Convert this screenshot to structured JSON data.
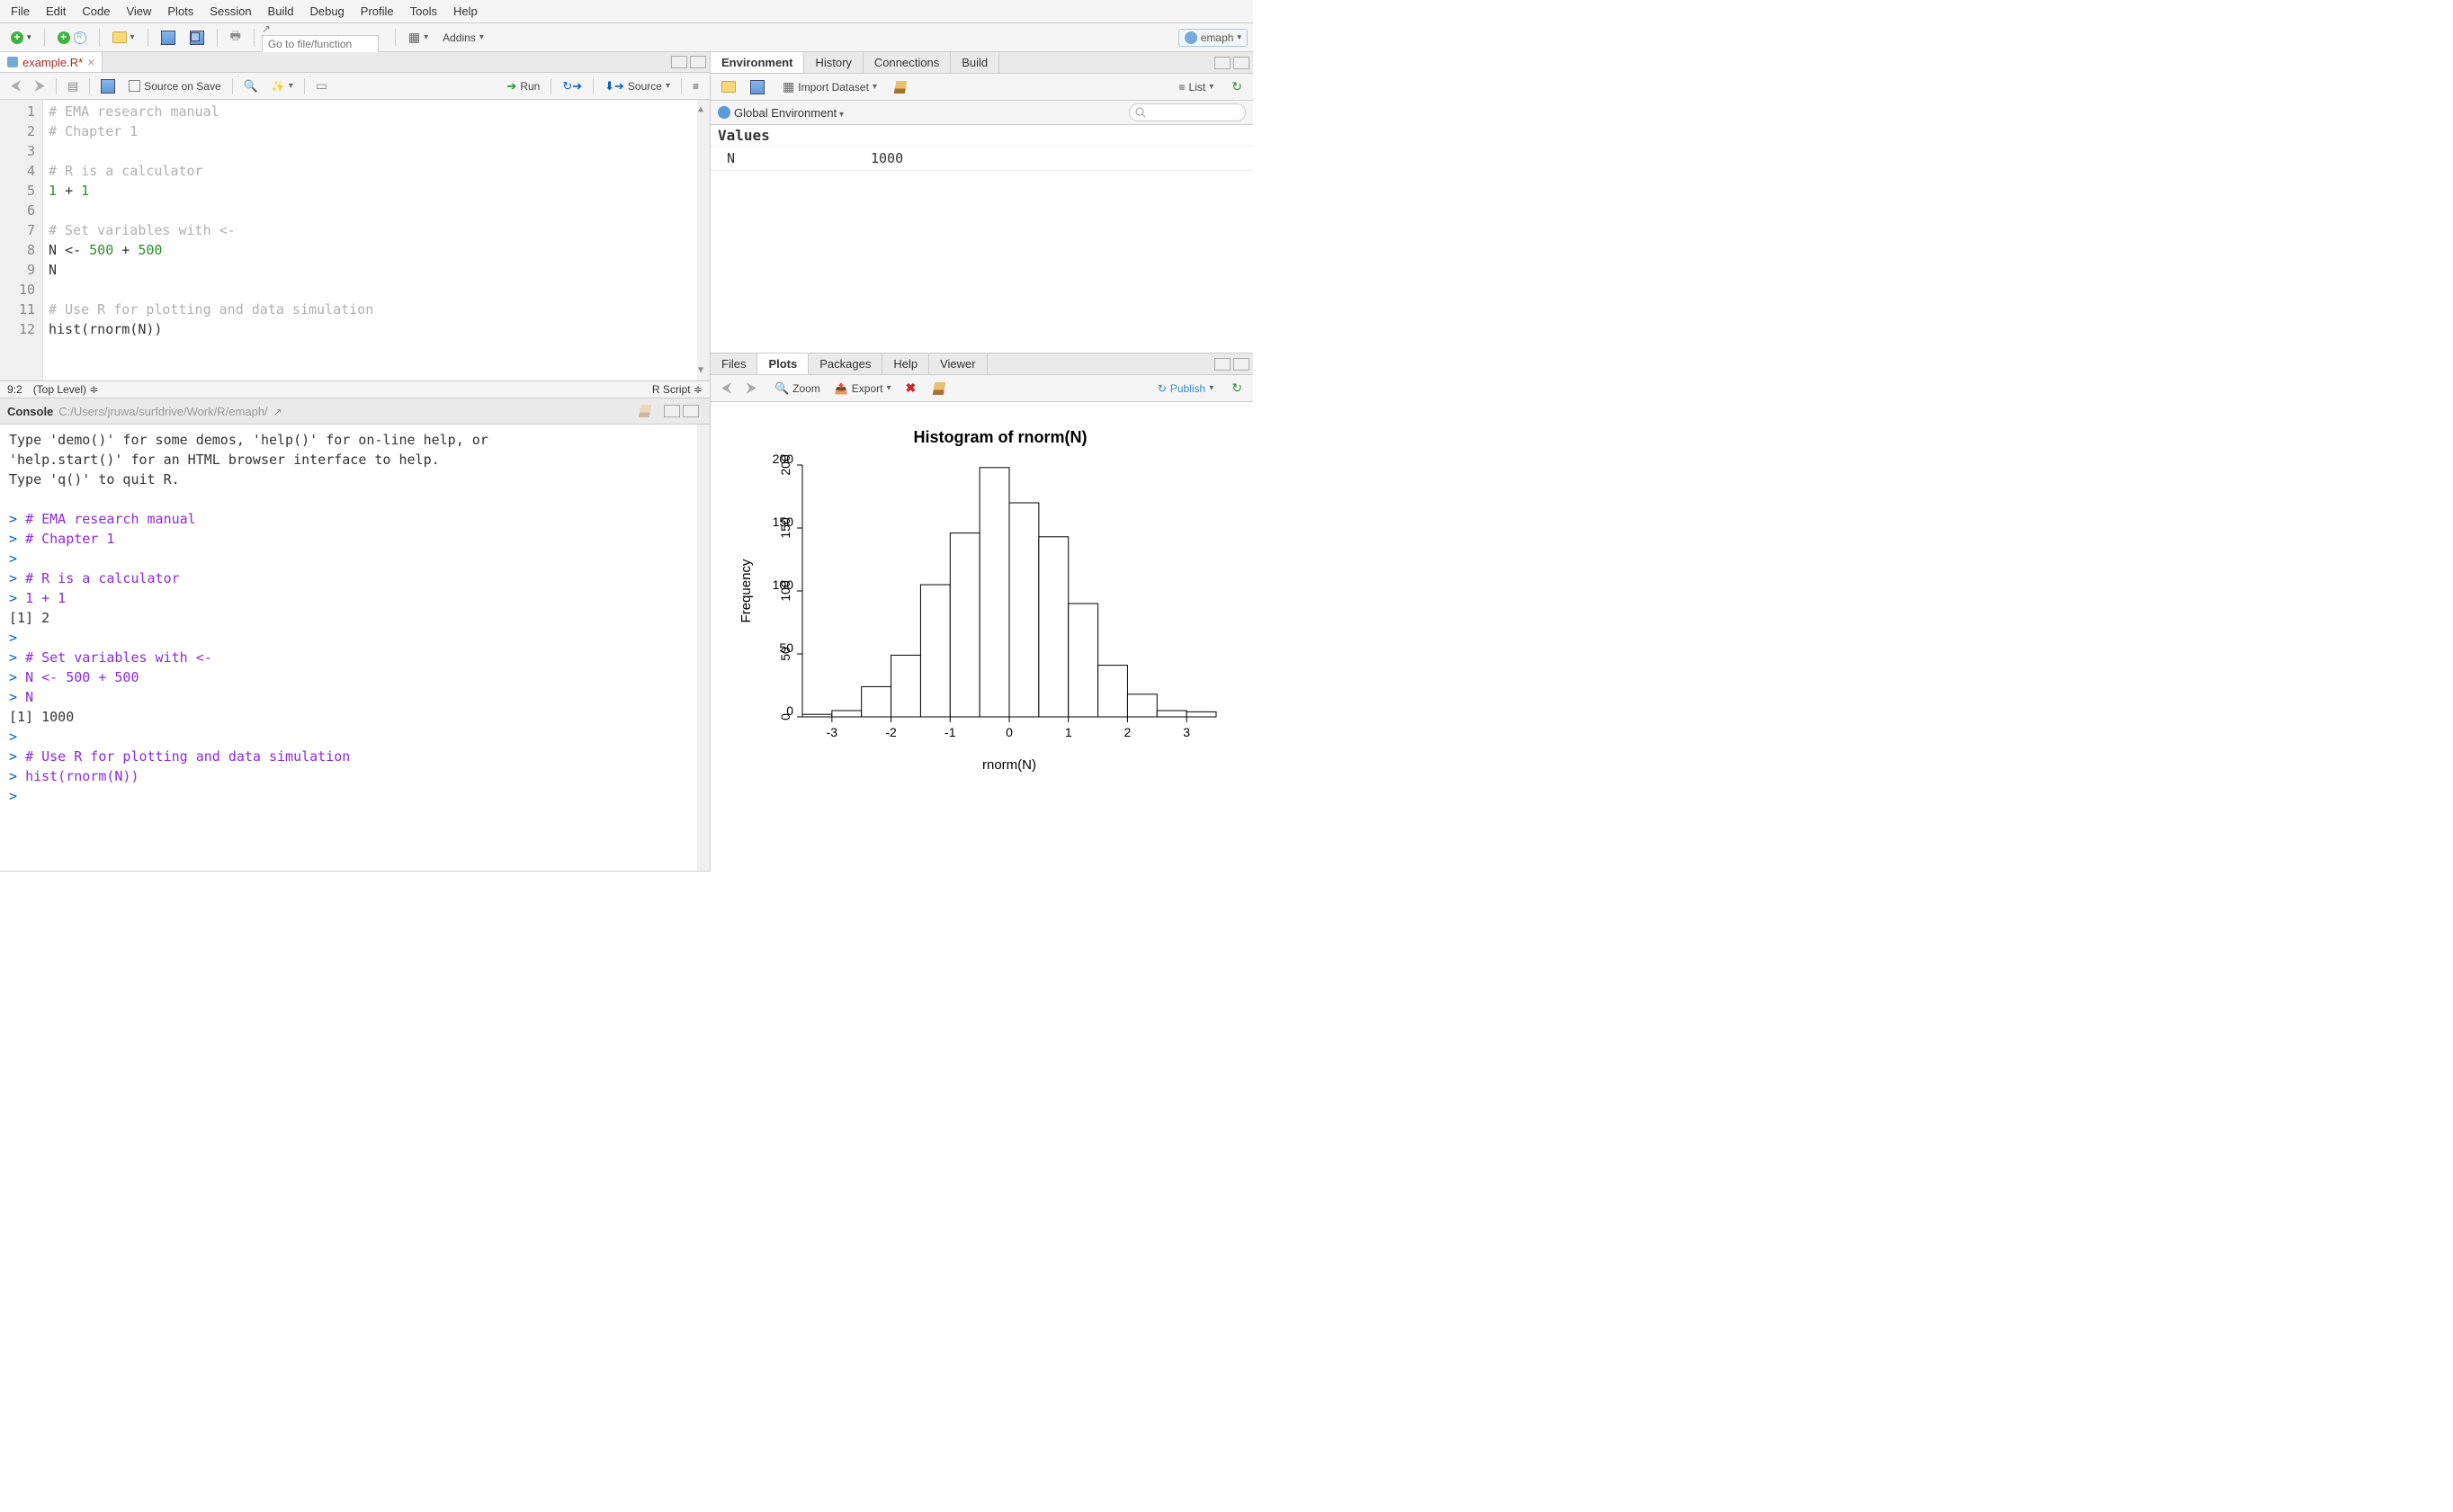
{
  "menu": [
    "File",
    "Edit",
    "Code",
    "View",
    "Plots",
    "Session",
    "Build",
    "Debug",
    "Profile",
    "Tools",
    "Help"
  ],
  "goto_placeholder": "Go to file/function",
  "addins_label": "Addins",
  "user": "emaph",
  "editor": {
    "filename": "example.R*",
    "source_on_save": "Source on Save",
    "run": "Run",
    "source_btn": "Source",
    "lines": [
      {
        "n": 1,
        "type": "comment",
        "text": "# EMA research manual"
      },
      {
        "n": 2,
        "type": "comment",
        "text": "# Chapter 1"
      },
      {
        "n": 3,
        "type": "blank",
        "text": ""
      },
      {
        "n": 4,
        "type": "comment",
        "text": "# R is a calculator"
      },
      {
        "n": 5,
        "type": "code",
        "html": "<span class='number'>1</span> <span class='op'>+</span> <span class='number'>1</span>"
      },
      {
        "n": 6,
        "type": "blank",
        "text": ""
      },
      {
        "n": 7,
        "type": "comment",
        "text": "# Set variables with <-"
      },
      {
        "n": 8,
        "type": "code",
        "html": "N <span class='op'>&lt;-</span> <span class='number'>500</span> <span class='op'>+</span> <span class='number'>500</span>"
      },
      {
        "n": 9,
        "type": "code",
        "html": "N"
      },
      {
        "n": 10,
        "type": "blank",
        "text": ""
      },
      {
        "n": 11,
        "type": "comment",
        "text": "# Use R for plotting and data simulation"
      },
      {
        "n": 12,
        "type": "code",
        "html": "hist(rnorm(N))"
      }
    ],
    "status_pos": "9:2",
    "status_scope": "(Top Level)",
    "status_type": "R Script"
  },
  "console": {
    "title": "Console",
    "path": "C:/Users/jruwa/surfdrive/Work/R/emaph/",
    "lines": [
      "Type 'demo()' for some demos, 'help()' for on-line help, or",
      "'help.start()' for an HTML browser interface to help.",
      "Type 'q()' to quit R.",
      "",
      "> # EMA research manual",
      "> # Chapter 1",
      "> ",
      "> # R is a calculator",
      "> 1 + 1",
      "[1] 2",
      "> ",
      "> # Set variables with <-",
      "> N <- 500 + 500",
      "> N",
      "[1] 1000",
      "> ",
      "> # Use R for plotting and data simulation",
      "> hist(rnorm(N))",
      "> "
    ]
  },
  "env": {
    "tabs": [
      "Environment",
      "History",
      "Connections",
      "Build"
    ],
    "import": "Import Dataset",
    "list": "List",
    "scope": "Global Environment",
    "section": "Values",
    "var_name": "N",
    "var_value": "1000"
  },
  "plots": {
    "tabs": [
      "Files",
      "Plots",
      "Packages",
      "Help",
      "Viewer"
    ],
    "zoom": "Zoom",
    "export": "Export",
    "publish": "Publish"
  },
  "chart_data": {
    "type": "bar",
    "title": "Histogram of rnorm(N)",
    "xlabel": "rnorm(N)",
    "ylabel": "Frequency",
    "x_ticks": [
      -3,
      -2,
      -1,
      0,
      1,
      2,
      3
    ],
    "y_ticks": [
      0,
      50,
      100,
      150,
      200
    ],
    "ylim": [
      0,
      200
    ],
    "bin_edges": [
      -3.5,
      -3.0,
      -2.5,
      -2.0,
      -1.5,
      -1.0,
      -0.5,
      0.0,
      0.5,
      1.0,
      1.5,
      2.0,
      2.5,
      3.0,
      3.5
    ],
    "values": [
      2,
      5,
      24,
      49,
      105,
      146,
      198,
      170,
      143,
      90,
      41,
      18,
      5,
      4
    ]
  }
}
